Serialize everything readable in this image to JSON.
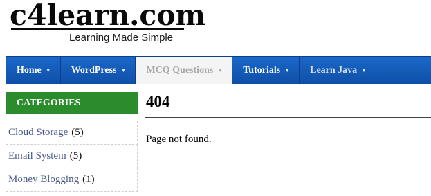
{
  "logo": {
    "title": "c4learn.com",
    "tagline": "Learning Made Simple"
  },
  "nav": {
    "items": [
      {
        "label": "Home",
        "caret": "▼"
      },
      {
        "label": "WordPress",
        "caret": "▼"
      },
      {
        "label": "MCQ Questions",
        "caret": "▼"
      },
      {
        "label": "Tutorials",
        "caret": "▼"
      },
      {
        "label": "Learn Java",
        "caret": "▼"
      }
    ],
    "active_item": "MCQ Questions"
  },
  "sidebar": {
    "header": "CATEGORIES",
    "items": [
      {
        "label": "Cloud Storage",
        "count": "(5)"
      },
      {
        "label": "Email System",
        "count": "(5)"
      },
      {
        "label": "Money Blogging",
        "count": "(1)"
      }
    ]
  },
  "main": {
    "title": "404",
    "text": "Page not found."
  },
  "colors": {
    "nav_bg": "#1459b8",
    "category_header_bg": "#2a8c2a",
    "link": "#4a5a8c"
  }
}
